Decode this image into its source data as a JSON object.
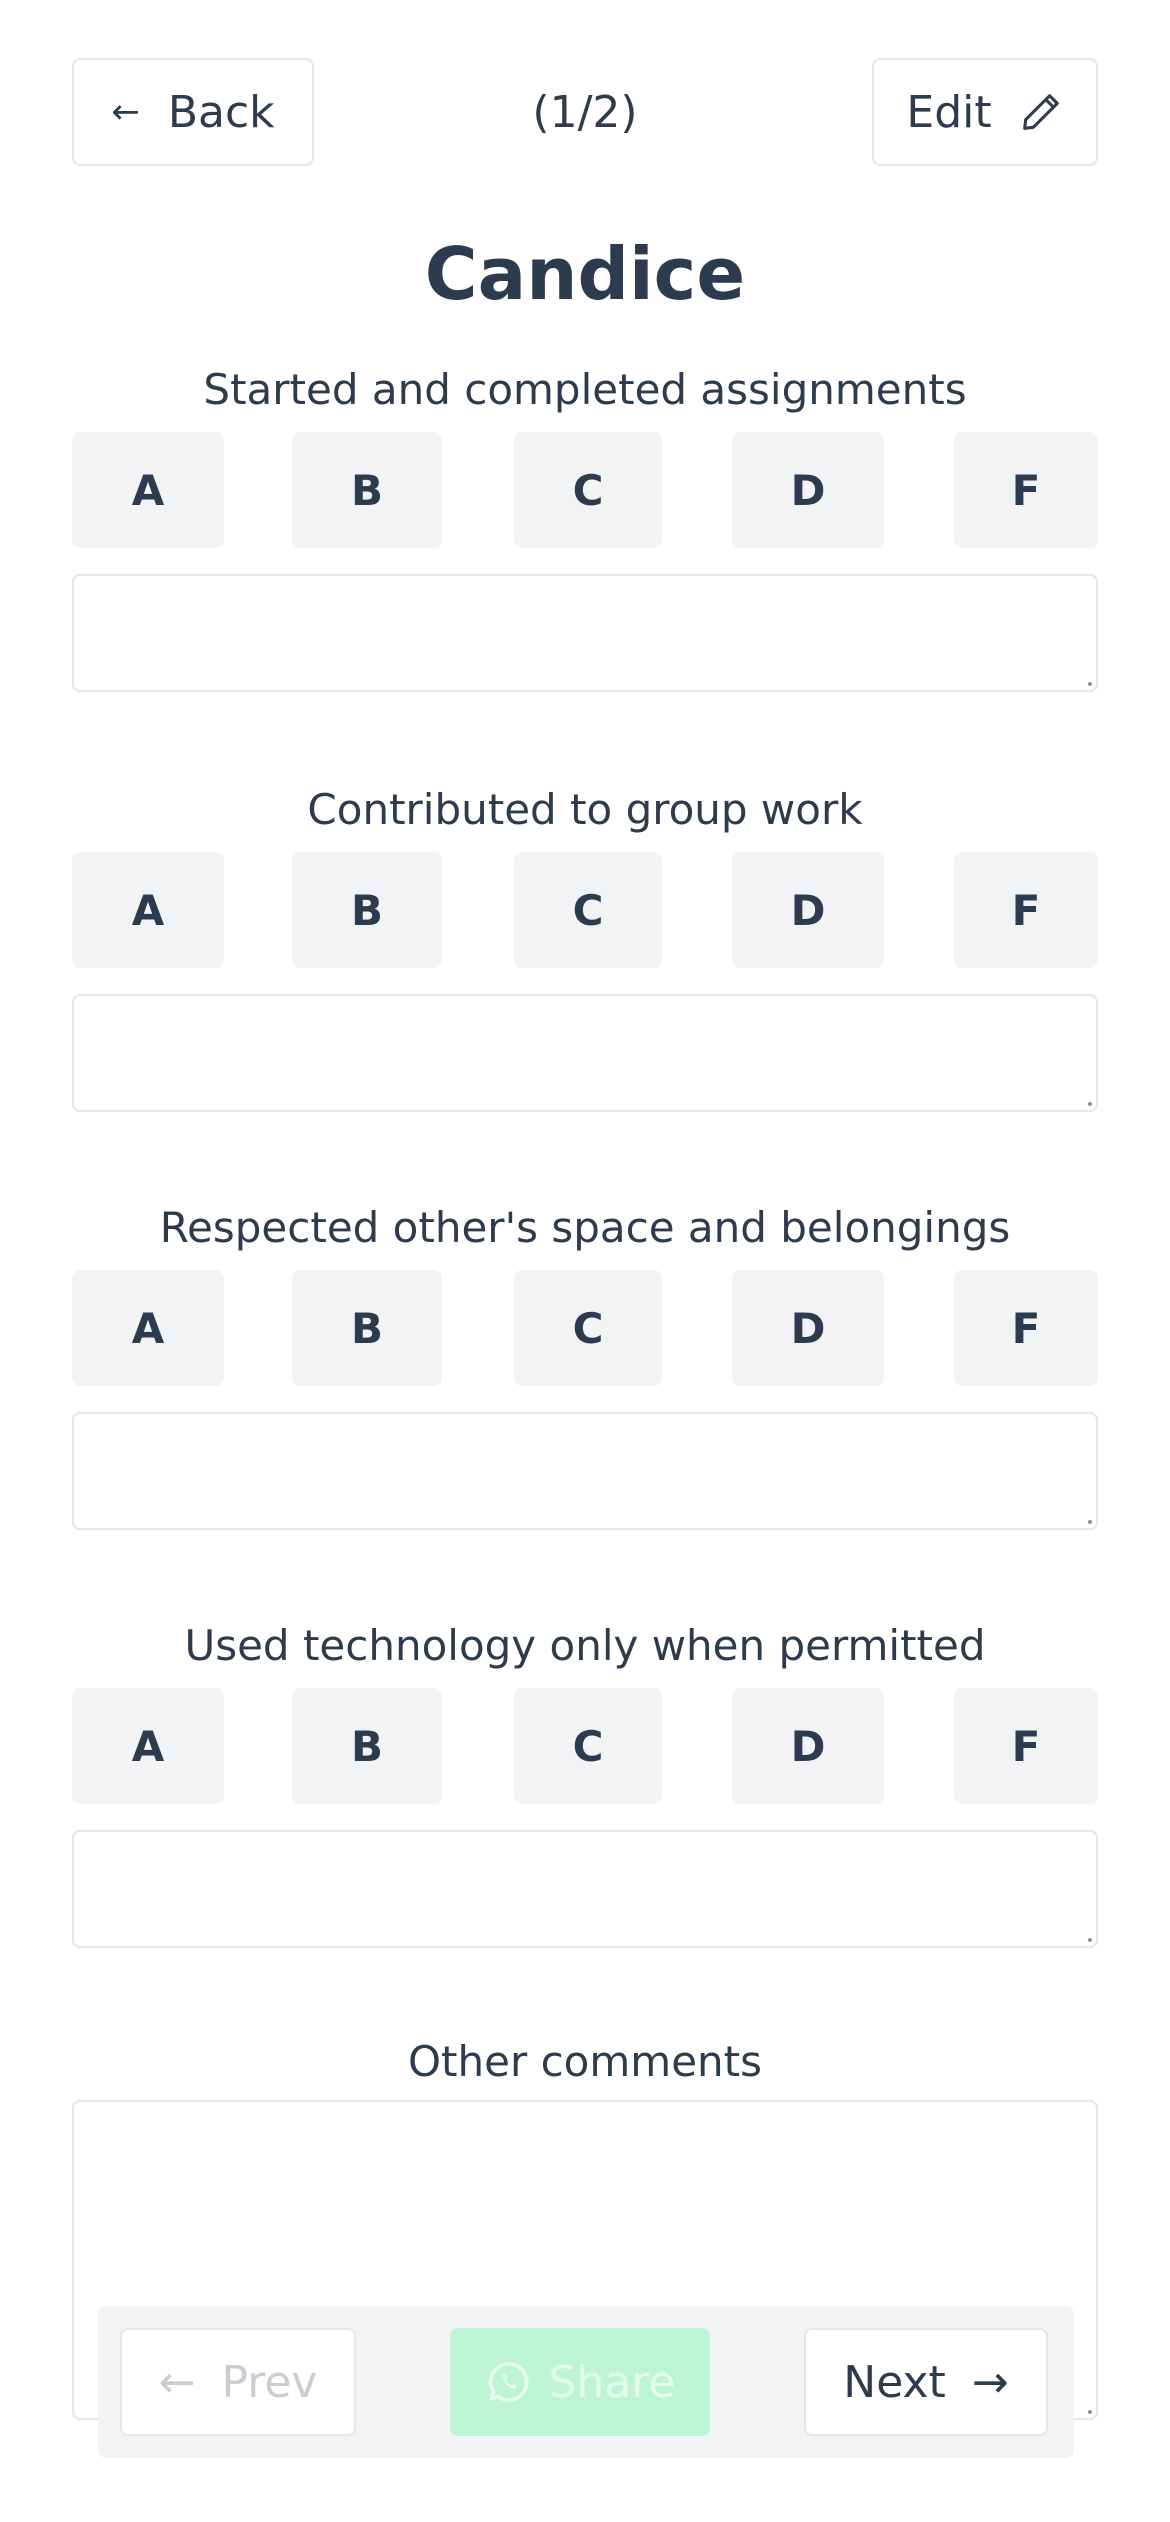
{
  "header": {
    "back_label": "Back",
    "back_icon": "arrow-left-icon",
    "counter": "(1/2)",
    "edit_label": "Edit",
    "edit_icon": "pencil-icon"
  },
  "student_name": "Candice",
  "grade_options": [
    "A",
    "B",
    "C",
    "D",
    "F"
  ],
  "criteria": [
    {
      "title": "Started and completed assignments",
      "note": ""
    },
    {
      "title": "Contributed to group work",
      "note": ""
    },
    {
      "title": "Respected other's space and belongings",
      "note": ""
    },
    {
      "title": "Used technology only when permitted",
      "note": ""
    }
  ],
  "comments": {
    "title": "Other comments",
    "value": ""
  },
  "footer": {
    "prev_label": "Prev",
    "share_label": "Share",
    "share_icon": "whatsapp-icon",
    "next_label": "Next"
  },
  "colors": {
    "text": "#2d3b4e",
    "grade_bg": "#f2f3f5",
    "border": "#e3e6ea",
    "share_bg": "#bdf5d4"
  }
}
